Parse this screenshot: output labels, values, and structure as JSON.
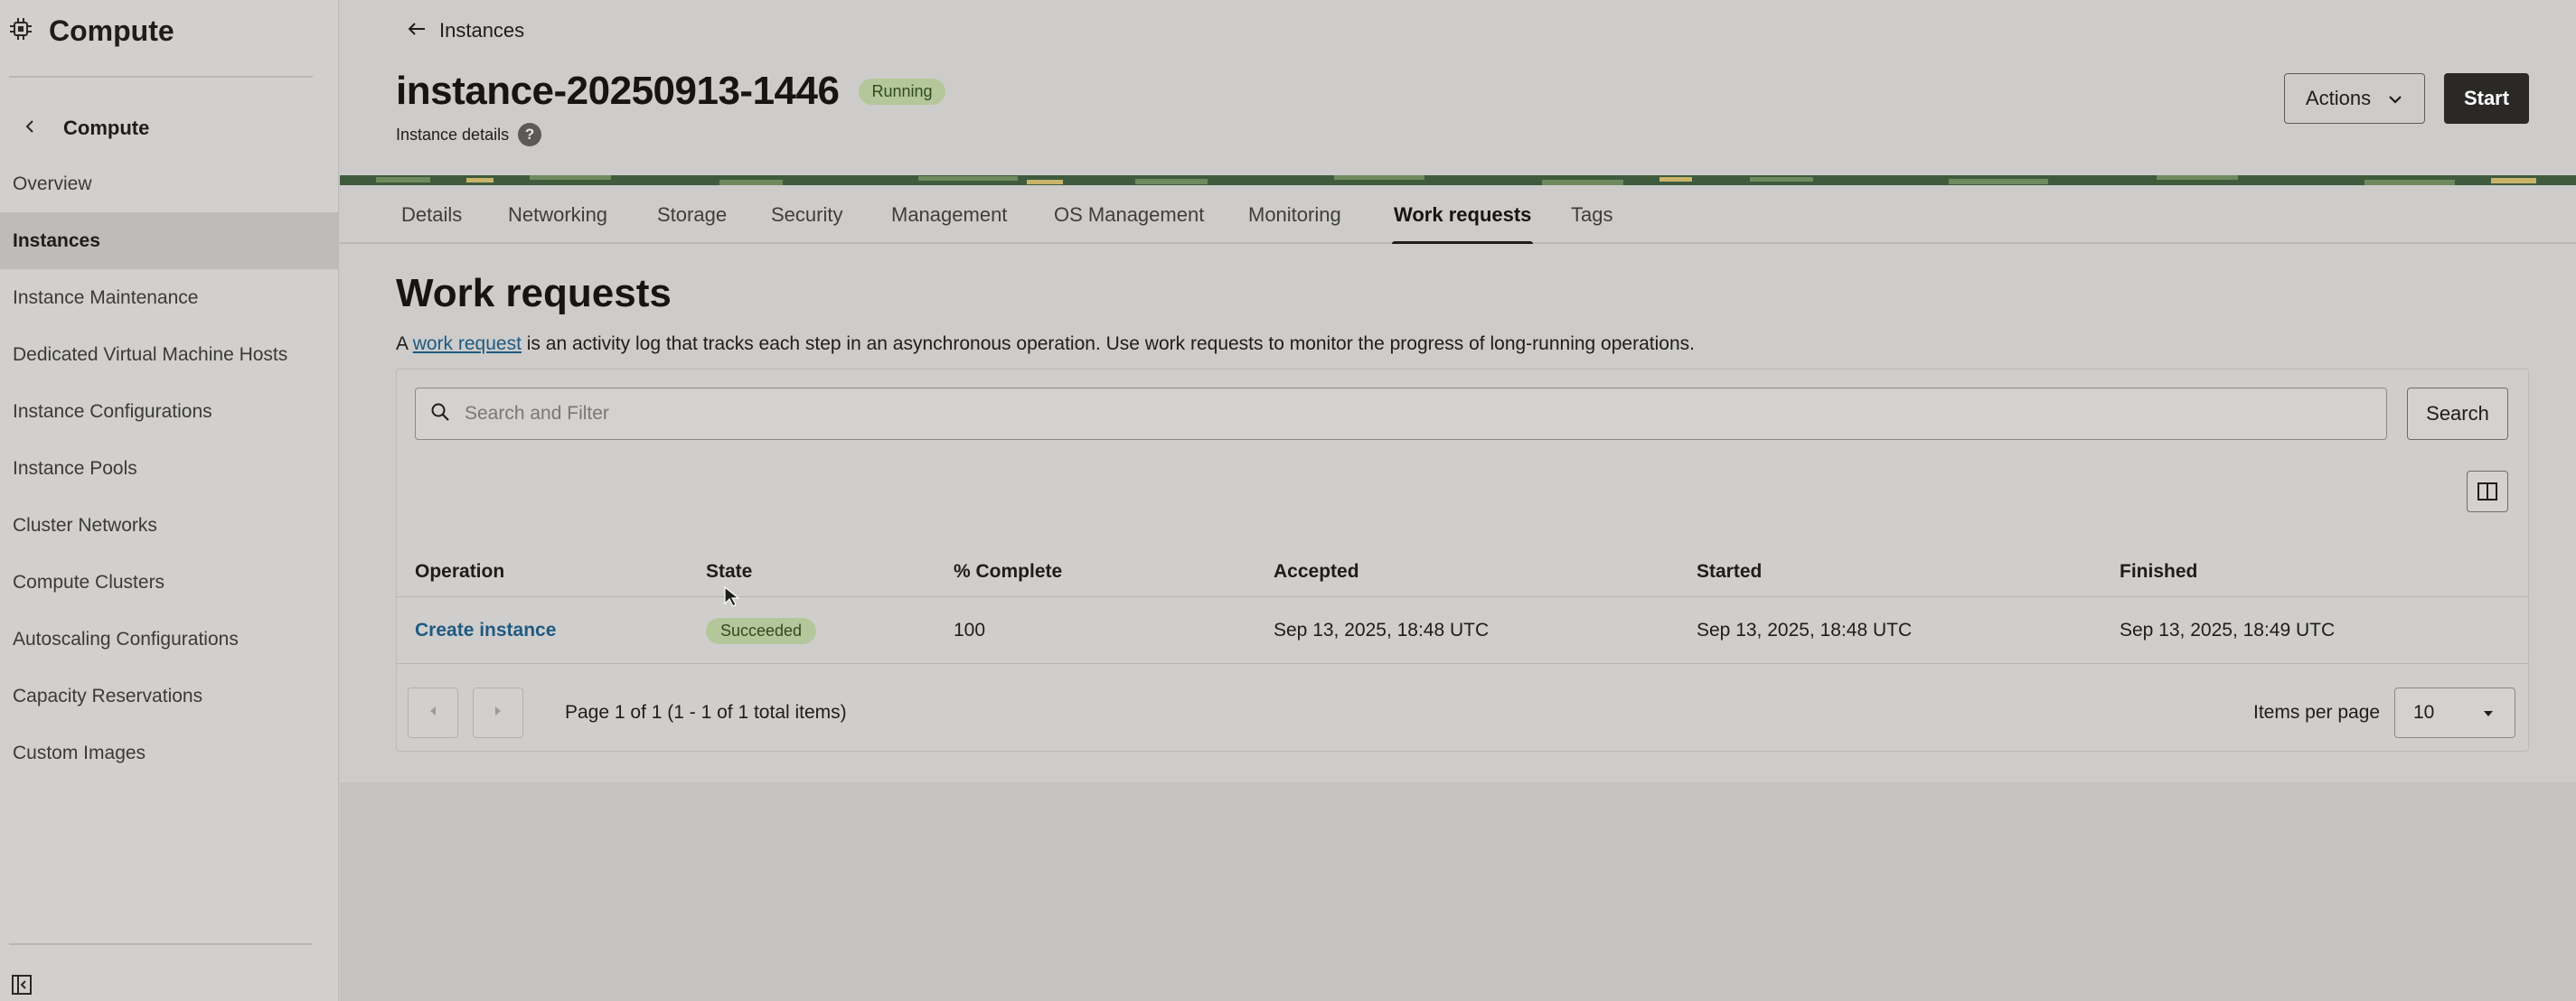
{
  "sidebar": {
    "app_title": "Compute",
    "back_label": "Compute",
    "items": [
      {
        "label": "Overview",
        "active": false
      },
      {
        "label": "Instances",
        "active": true
      },
      {
        "label": "Instance Maintenance",
        "active": false
      },
      {
        "label": "Dedicated Virtual Machine Hosts",
        "active": false
      },
      {
        "label": "Instance Configurations",
        "active": false
      },
      {
        "label": "Instance Pools",
        "active": false
      },
      {
        "label": "Cluster Networks",
        "active": false
      },
      {
        "label": "Compute Clusters",
        "active": false
      },
      {
        "label": "Autoscaling Configurations",
        "active": false
      },
      {
        "label": "Capacity Reservations",
        "active": false
      },
      {
        "label": "Custom Images",
        "active": false
      }
    ]
  },
  "header": {
    "breadcrumb": "Instances",
    "instance_name": "instance-20250913-1446",
    "status": "Running",
    "subtitle": "Instance details",
    "help_glyph": "?",
    "actions_label": "Actions",
    "start_label": "Start"
  },
  "tabs": [
    {
      "label": "Details",
      "active": false
    },
    {
      "label": "Networking",
      "active": false
    },
    {
      "label": "Storage",
      "active": false
    },
    {
      "label": "Security",
      "active": false
    },
    {
      "label": "Management",
      "active": false
    },
    {
      "label": "OS Management",
      "active": false
    },
    {
      "label": "Monitoring",
      "active": false
    },
    {
      "label": "Work requests",
      "active": true
    },
    {
      "label": "Tags",
      "active": false
    }
  ],
  "work_requests": {
    "title": "Work requests",
    "desc_prefix": "A",
    "desc_link": "work request",
    "desc_suffix": "is an activity log that tracks each step in an asynchronous operation. Use work requests to monitor the progress of long-running operations.",
    "search_placeholder": "Search and Filter",
    "search_button": "Search",
    "columns": [
      "Operation",
      "State",
      "% Complete",
      "Accepted",
      "Started",
      "Finished"
    ],
    "rows": [
      {
        "operation": "Create instance",
        "state": "Succeeded",
        "percent_complete": "100",
        "accepted": "Sep 13, 2025, 18:48 UTC",
        "started": "Sep 13, 2025, 18:48 UTC",
        "finished": "Sep 13, 2025, 18:49 UTC"
      }
    ],
    "pagination": {
      "page_info": "Page 1 of 1 (1 - 1 of 1 total items)",
      "items_per_page_label": "Items per page",
      "items_per_page": "10"
    }
  },
  "icons": {
    "app": "chip-icon",
    "back": "chevron-left-icon",
    "breadcrumb": "arrow-left-icon",
    "search": "search-icon",
    "columns": "columns-icon",
    "collapse": "sidebar-collapse-icon"
  },
  "colors": {
    "running_badge": "#b4c79b",
    "link": "#1f5a82",
    "primary_button": "#2a2927"
  }
}
